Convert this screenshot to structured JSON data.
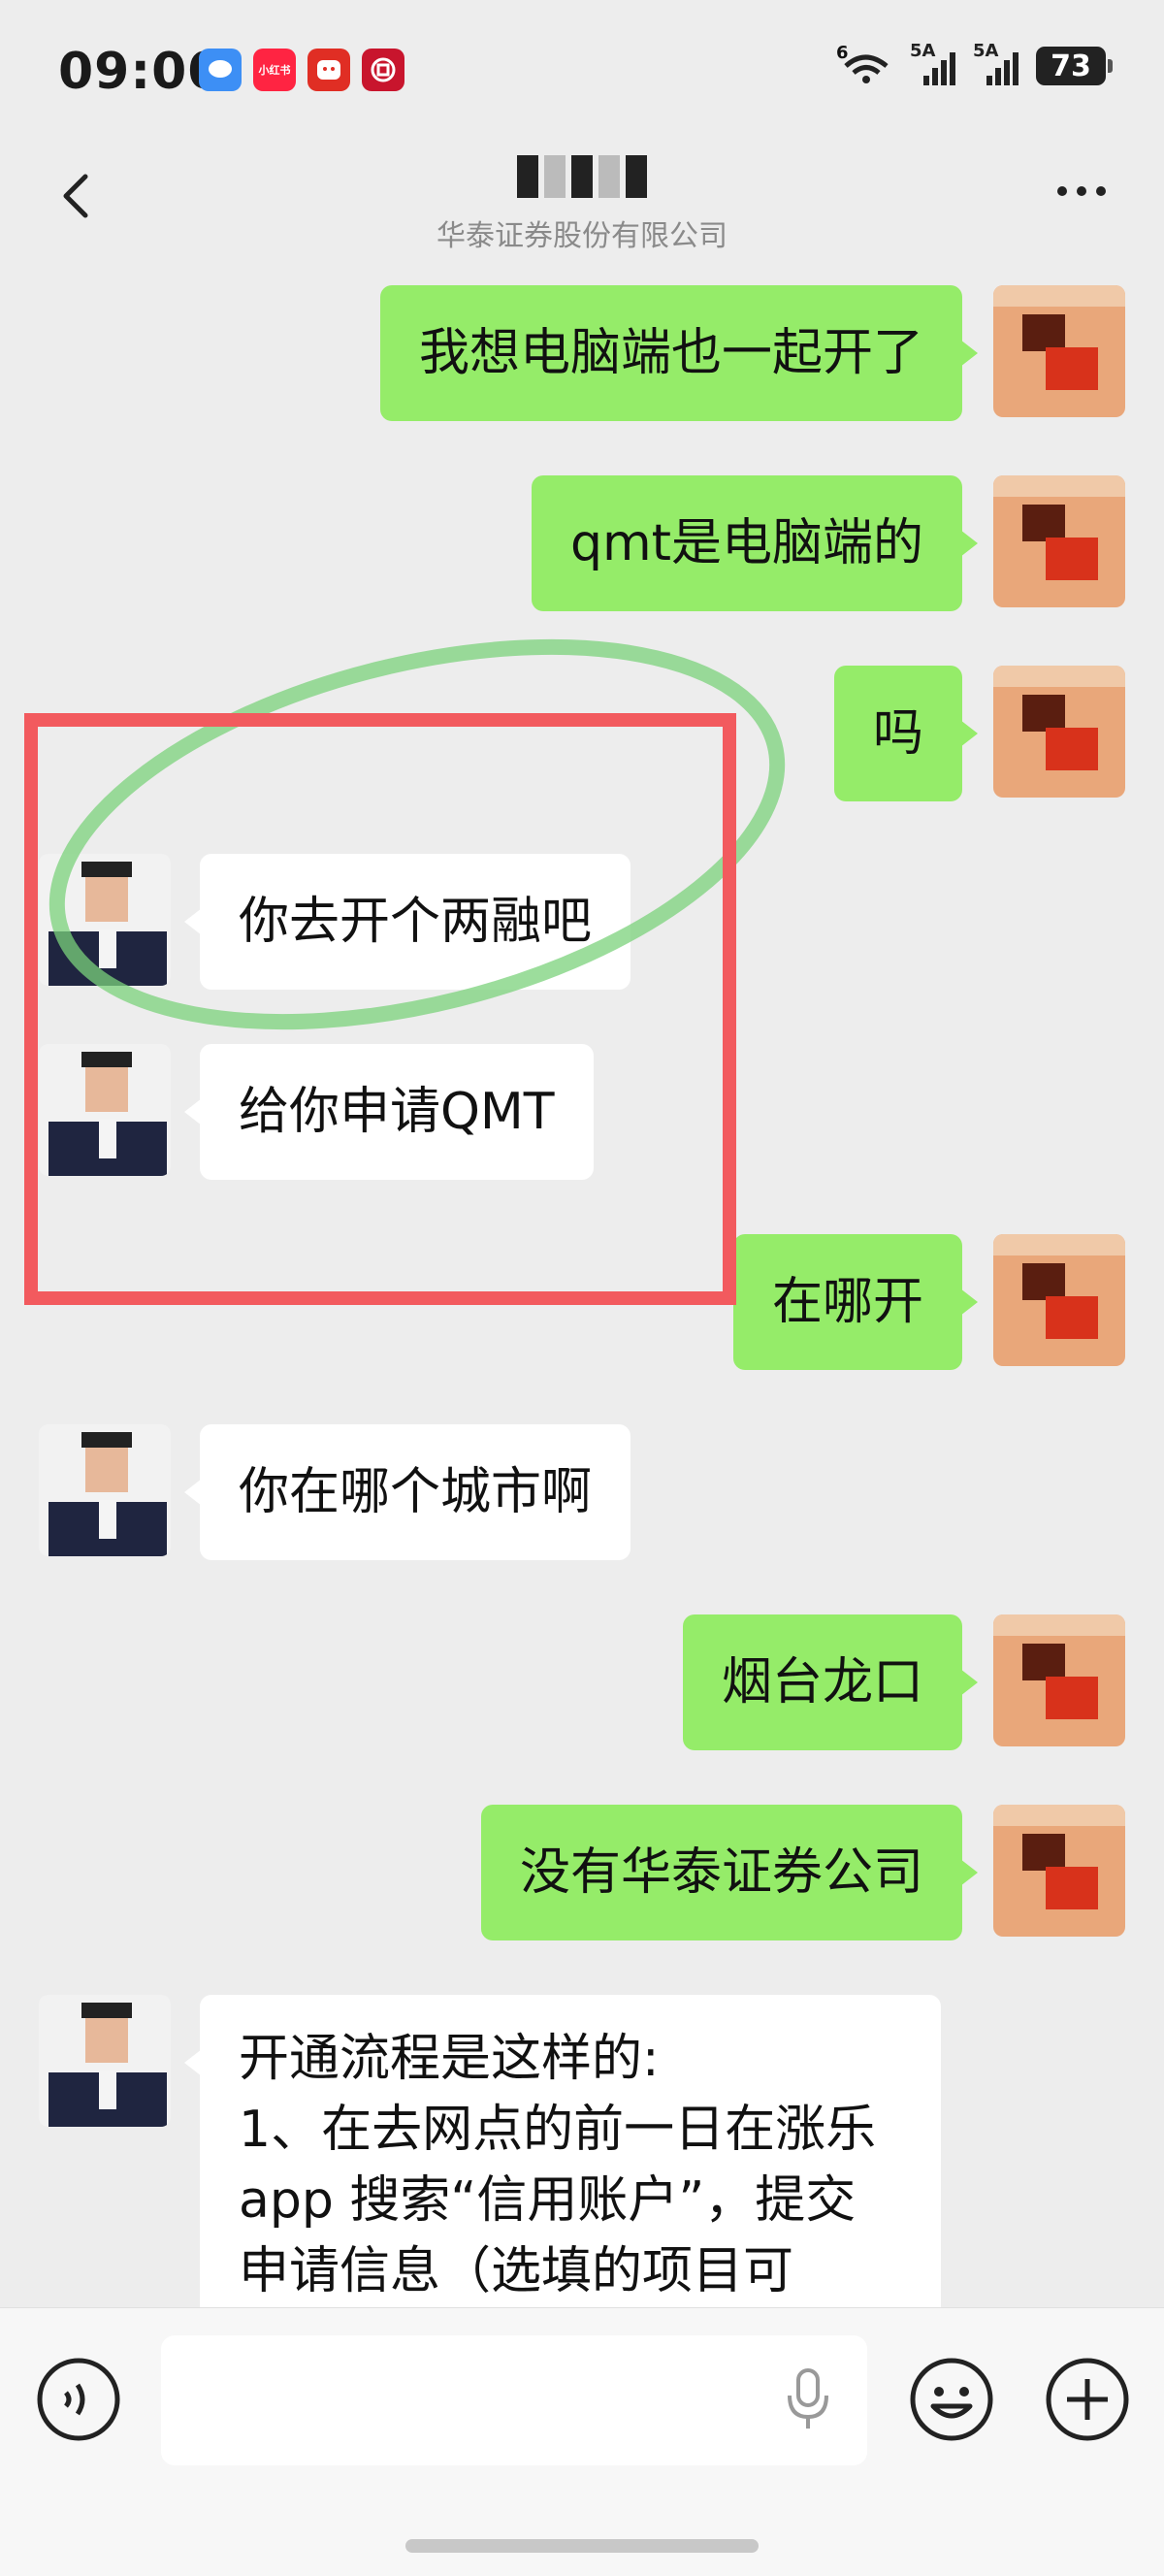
{
  "status_bar": {
    "time": "09:00",
    "apps": [
      {
        "icon": "messages-app-icon",
        "label": "",
        "color": "#3d8ff5"
      },
      {
        "icon": "xiaohongshu-app-icon",
        "label": "小红书",
        "color": "#ff2442"
      },
      {
        "icon": "pinduoduo-app-icon",
        "label": "",
        "color": "#e02e24"
      },
      {
        "icon": "bank-app-icon",
        "label": "",
        "color": "#c8152d"
      }
    ],
    "wifi_label": "6",
    "signal_1_label": "5A",
    "signal_2_label": "5A",
    "battery": "73"
  },
  "header": {
    "title": "",
    "subtitle": "华泰证券股份有限公司"
  },
  "messages": [
    {
      "side": "out",
      "text": "我想电脑端也一起开了"
    },
    {
      "side": "out",
      "text": "qmt是电脑端的"
    },
    {
      "side": "out",
      "text": "吗"
    },
    {
      "side": "in",
      "text": "你去开个两融吧"
    },
    {
      "side": "in",
      "text": "给你申请QMT"
    },
    {
      "side": "out",
      "text": "在哪开"
    },
    {
      "side": "in",
      "text": "你在哪个城市啊"
    },
    {
      "side": "out",
      "text": "烟台龙口"
    },
    {
      "side": "out",
      "text": "没有华泰证券公司"
    },
    {
      "side": "in",
      "text": "开通流程是这样的:\n1、在去网点的前一日在涨乐app 搜索“信用账户”，提交申请信息（选填的项目可"
    }
  ],
  "input": {
    "value": "",
    "placeholder": ""
  },
  "colors": {
    "outgoing_bubble": "#95ec69",
    "incoming_bubble": "#ffffff",
    "background": "#ededed",
    "annotation_box": "#f25a5e",
    "annotation_circle": "#7bd27b"
  }
}
